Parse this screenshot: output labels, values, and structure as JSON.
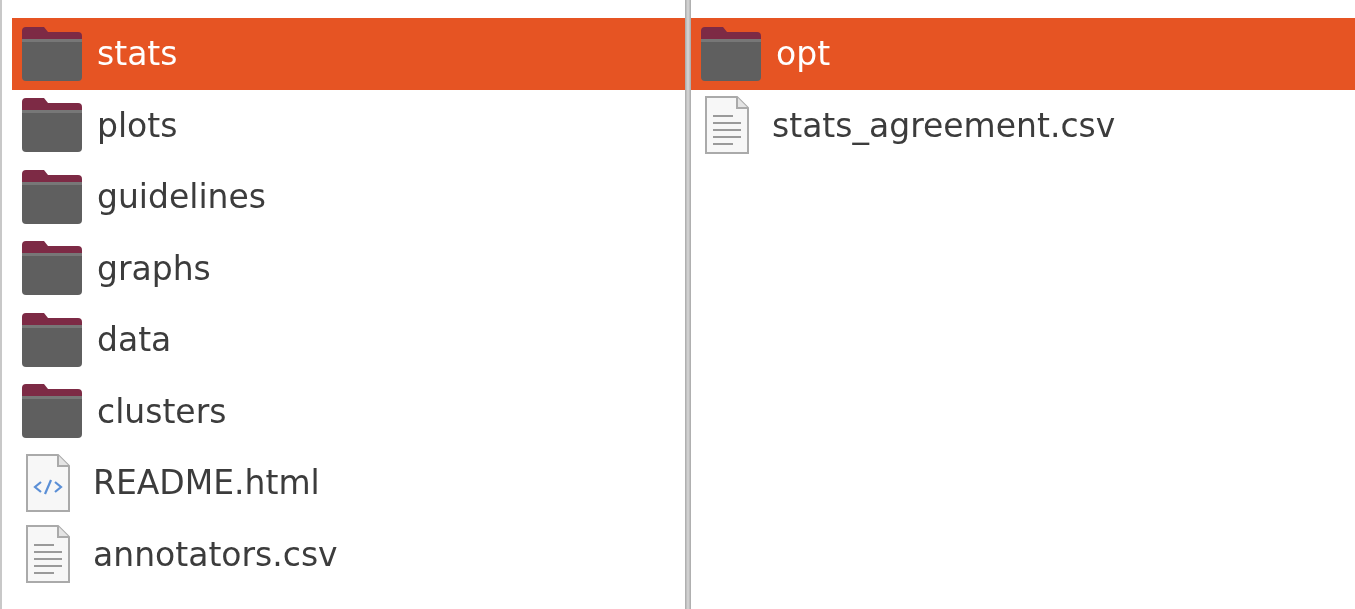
{
  "columns": [
    {
      "items": [
        {
          "name": "stats",
          "kind": "folder",
          "selected": true
        },
        {
          "name": "plots",
          "kind": "folder",
          "selected": false
        },
        {
          "name": "guidelines",
          "kind": "folder",
          "selected": false
        },
        {
          "name": "graphs",
          "kind": "folder",
          "selected": false
        },
        {
          "name": "data",
          "kind": "folder",
          "selected": false
        },
        {
          "name": "clusters",
          "kind": "folder",
          "selected": false
        },
        {
          "name": "README.html",
          "kind": "html",
          "selected": false
        },
        {
          "name": "annotators.csv",
          "kind": "text",
          "selected": false
        }
      ]
    },
    {
      "items": [
        {
          "name": "opt",
          "kind": "folder",
          "selected": true
        },
        {
          "name": "stats_agreement.csv",
          "kind": "text",
          "selected": false
        }
      ]
    }
  ]
}
